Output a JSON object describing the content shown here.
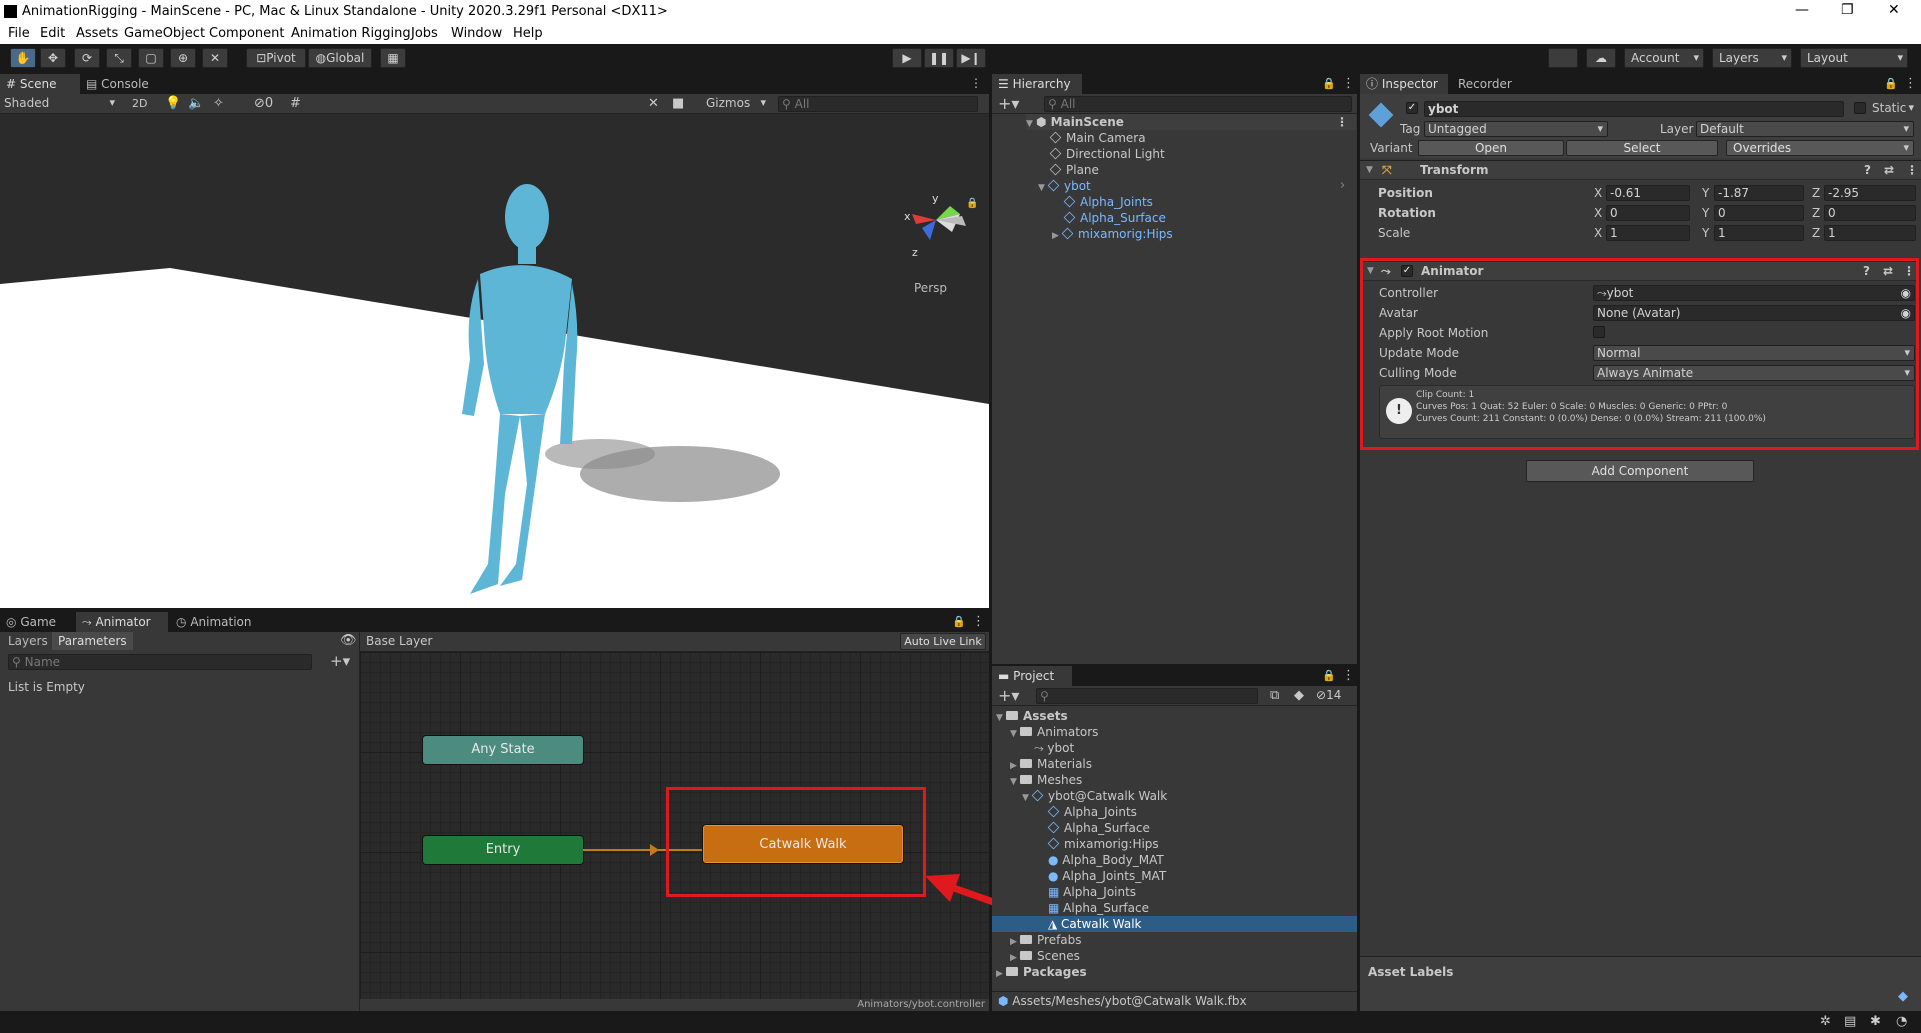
{
  "window": {
    "title": "AnimationRigging - MainScene - PC, Mac & Linux Standalone - Unity 2020.3.29f1 Personal <DX11>",
    "controls": [
      "—",
      "❐",
      "✕"
    ]
  },
  "menu": [
    "File",
    "Edit",
    "Assets",
    "GameObject",
    "Component",
    "Animation Rigging",
    "Jobs",
    "Window",
    "Help"
  ],
  "toolbar": {
    "pivot": "Pivot",
    "global": "Global",
    "account": "Account",
    "layers": "Layers",
    "layout": "Layout"
  },
  "scene": {
    "tabs": [
      "Scene",
      "Console"
    ],
    "shading": "Shaded",
    "mode2d": "2D",
    "hidden_count": "0",
    "gizmos": "Gizmos",
    "search_placeholder": "All",
    "persp": "Persp",
    "axes": {
      "x": "x",
      "y": "y",
      "z": "z"
    }
  },
  "hierarchy": {
    "tab": "Hierarchy",
    "search_placeholder": "All",
    "items": [
      {
        "label": "MainScene",
        "indent": 0,
        "kind": "scene"
      },
      {
        "label": "Main Camera",
        "indent": 1,
        "kind": "object"
      },
      {
        "label": "Directional Light",
        "indent": 1,
        "kind": "object"
      },
      {
        "label": "Plane",
        "indent": 1,
        "kind": "object"
      },
      {
        "label": "ybot",
        "indent": 1,
        "kind": "prefab"
      },
      {
        "label": "Alpha_Joints",
        "indent": 2,
        "kind": "prefab"
      },
      {
        "label": "Alpha_Surface",
        "indent": 2,
        "kind": "prefab"
      },
      {
        "label": "mixamorig:Hips",
        "indent": 2,
        "kind": "prefab"
      }
    ]
  },
  "inspector": {
    "tabs": [
      "Inspector",
      "Recorder"
    ],
    "object_name": "ybot",
    "static": "Static",
    "tag_label": "Tag",
    "tag_value": "Untagged",
    "layer_label": "Layer",
    "layer_value": "Default",
    "variant_label": "Variant",
    "open": "Open",
    "select": "Select",
    "overrides": "Overrides",
    "transform": {
      "title": "Transform",
      "rows": [
        {
          "label": "Position",
          "x": "-0.61",
          "y": "-1.87",
          "z": "-2.95"
        },
        {
          "label": "Rotation",
          "x": "0",
          "y": "0",
          "z": "0"
        },
        {
          "label": "Scale",
          "x": "1",
          "y": "1",
          "z": "1"
        }
      ],
      "axis": {
        "x": "X",
        "y": "Y",
        "z": "Z"
      }
    },
    "animator": {
      "title": "Animator",
      "rows": [
        {
          "label": "Controller",
          "value": "ybot"
        },
        {
          "label": "Avatar",
          "value": "None (Avatar)"
        },
        {
          "label": "Apply Root Motion",
          "value": ""
        },
        {
          "label": "Update Mode",
          "value": "Normal"
        },
        {
          "label": "Culling Mode",
          "value": "Always Animate"
        }
      ],
      "info": [
        "Clip Count: 1",
        "Curves Pos: 1 Quat: 52 Euler: 0 Scale: 0 Muscles: 0 Generic: 0 PPtr: 0",
        "Curves Count: 211 Constant: 0 (0.0%) Dense: 0 (0.0%) Stream: 211 (100.0%)"
      ]
    },
    "add_component": "Add Component",
    "asset_labels": "Asset Labels",
    "highlight_color": "#e0191f"
  },
  "animator_window": {
    "tabs": [
      "Game",
      "Animator",
      "Animation"
    ],
    "subtabs": [
      "Layers",
      "Parameters"
    ],
    "search_placeholder": "Name",
    "empty": "List is Empty",
    "layer": "Base Layer",
    "auto_live_link": "Auto Live Link",
    "nodes": {
      "any": "Any State",
      "entry": "Entry",
      "state": "Catwalk Walk"
    },
    "path": "Animators/ybot.controller"
  },
  "project": {
    "tab": "Project",
    "hidden_count": "14",
    "items": [
      {
        "label": "Assets",
        "indent": 0,
        "kind": "folder",
        "bold": true
      },
      {
        "label": "Animators",
        "indent": 1,
        "kind": "folder"
      },
      {
        "label": "ybot",
        "indent": 2,
        "kind": "controller"
      },
      {
        "label": "Materials",
        "indent": 1,
        "kind": "folder"
      },
      {
        "label": "Meshes",
        "indent": 1,
        "kind": "folder"
      },
      {
        "label": "ybot@Catwalk Walk",
        "indent": 2,
        "kind": "model"
      },
      {
        "label": "Alpha_Joints",
        "indent": 3,
        "kind": "model"
      },
      {
        "label": "Alpha_Surface",
        "indent": 3,
        "kind": "model"
      },
      {
        "label": "mixamorig:Hips",
        "indent": 3,
        "kind": "model"
      },
      {
        "label": "Alpha_Body_MAT",
        "indent": 3,
        "kind": "material"
      },
      {
        "label": "Alpha_Joints_MAT",
        "indent": 3,
        "kind": "material"
      },
      {
        "label": "Alpha_Joints",
        "indent": 3,
        "kind": "mesh"
      },
      {
        "label": "Alpha_Surface",
        "indent": 3,
        "kind": "mesh"
      },
      {
        "label": "Catwalk Walk",
        "indent": 3,
        "kind": "clip",
        "selected": true
      },
      {
        "label": "Prefabs",
        "indent": 1,
        "kind": "folder"
      },
      {
        "label": "Scenes",
        "indent": 1,
        "kind": "folder"
      },
      {
        "label": "Packages",
        "indent": 0,
        "kind": "folder",
        "bold": true
      }
    ],
    "path": "Assets/Meshes/ybot@Catwalk Walk.fbx"
  }
}
